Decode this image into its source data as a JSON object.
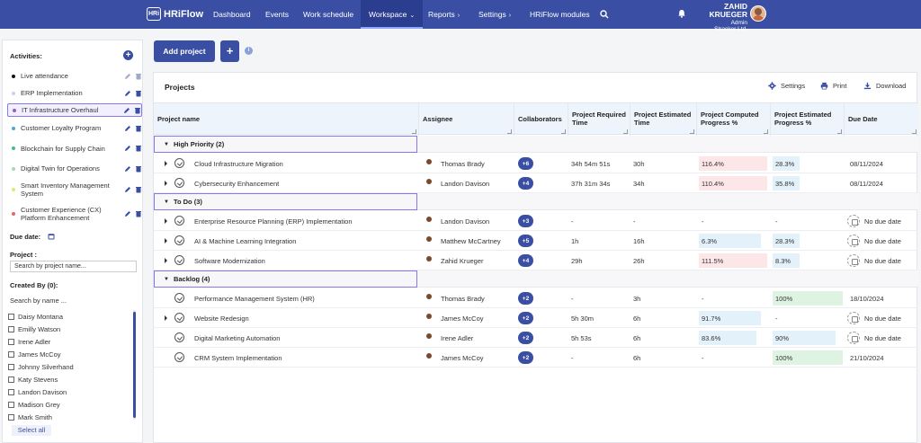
{
  "app": {
    "logo_mark": "HRi",
    "logo_text": "HRiFlow"
  },
  "nav": {
    "items": [
      {
        "label": "Dashboard"
      },
      {
        "label": "Events"
      },
      {
        "label": "Work schedule"
      },
      {
        "label": "Workspace",
        "chevron": "⌄"
      },
      {
        "label": "Reports",
        "chevron": "›"
      },
      {
        "label": "Settings",
        "chevron": "›"
      },
      {
        "label": "HRiFlow modules"
      }
    ],
    "user": {
      "name": "ZAHID KRUEGER",
      "role": "Admin",
      "company": "Stracker Ltd."
    }
  },
  "sidebar": {
    "activities_label": "Activities:",
    "activities": [
      {
        "label": "Live attendance",
        "color": "#111111"
      },
      {
        "label": "ERP Implementation",
        "color": "#c9d2f0"
      },
      {
        "label": "IT Infrastructure Overhaul",
        "color": "#9b59d0"
      },
      {
        "label": "Customer Loyalty Program",
        "color": "#4fa7d9"
      },
      {
        "label": "Blockchain for Supply Chain",
        "color": "#3cbf8a"
      },
      {
        "label": "Digital Twin for Operations",
        "color": "#9be0b0"
      },
      {
        "label": "Smart Inventory Management System",
        "color": "#d6ea72"
      },
      {
        "label": "Customer Experience (CX) Platform Enhancement",
        "color": "#e06b6b"
      }
    ],
    "due_date_label": "Due date:",
    "project_label": "Project :",
    "project_placeholder": "Search by project name...",
    "created_by_label": "Created By (0):",
    "search_name_label": "Search by name ...",
    "people": [
      "Daisy Montana",
      "Emilly Watson",
      "Irene Adler",
      "James McCoy",
      "Johnny Silverhand",
      "Katy Stevens",
      "Landon Davison",
      "Madison Grey",
      "Mark Smith"
    ],
    "select_all_label": "Select all"
  },
  "toolbar": {
    "add_project_label": "Add project",
    "plus_label": "+",
    "info_label": "i"
  },
  "panel": {
    "title": "Projects",
    "settings_label": "Settings",
    "print_label": "Print",
    "download_label": "Download",
    "columns": [
      "Project name",
      "Assignee",
      "Collaborators",
      "Project Required Time",
      "Project Estimated Time",
      "Project Computed Progress %",
      "Project Estimated Progress %",
      "Due Date"
    ]
  },
  "groups": [
    {
      "label": "High Priority (2)",
      "rows": [
        {
          "name": "Cloud Infrastructure Migration",
          "expandable": true,
          "assignee": "Thomas Brady",
          "avatar_color": "#9fb3cf",
          "collab": "+6",
          "required": "34h 54m 51s",
          "estimated": "30h",
          "computed": "116.4%",
          "computed_style": "red",
          "computed_fill": 0.98,
          "est_progress": "28.3%",
          "est_style": "blue",
          "est_fill": 0.28,
          "due": "08/11/2024"
        },
        {
          "name": "Cybersecurity Enhancement",
          "expandable": true,
          "assignee": "Landon Davison",
          "avatar_color": "#e4a07c",
          "collab": "+4",
          "required": "37h 31m 34s",
          "estimated": "34h",
          "computed": "110.4%",
          "computed_style": "red",
          "computed_fill": 0.98,
          "est_progress": "35.8%",
          "est_style": "blue",
          "est_fill": 0.36,
          "due": "08/11/2024"
        }
      ]
    },
    {
      "label": "To Do (3)",
      "rows": [
        {
          "name": "Enterprise Resource Planning (ERP) Implementation",
          "expandable": true,
          "assignee": "Landon Davison",
          "avatar_color": "#e4a07c",
          "collab": "+3",
          "required": "-",
          "estimated": "-",
          "computed": "-",
          "computed_style": "",
          "computed_fill": 0,
          "est_progress": "-",
          "est_style": "",
          "est_fill": 0,
          "due": "No due date"
        },
        {
          "name": "AI & Machine Learning Integration",
          "expandable": true,
          "assignee": "Matthew McCartney",
          "avatar_color": "#c9837a",
          "collab": "+5",
          "required": "1h",
          "estimated": "16h",
          "computed": "6.3%",
          "computed_style": "blue",
          "computed_fill": 0.06,
          "est_progress": "28.3%",
          "est_style": "blue",
          "est_fill": 0.28,
          "due": "No due date"
        },
        {
          "name": "Software Modernization",
          "expandable": true,
          "assignee": "Zahid Krueger",
          "avatar_color": "#e3b697",
          "collab": "+4",
          "required": "29h",
          "estimated": "26h",
          "computed": "111.5%",
          "computed_style": "red",
          "computed_fill": 0.98,
          "est_progress": "8.3%",
          "est_style": "blue",
          "est_fill": 0.08,
          "due": "No due date"
        }
      ]
    },
    {
      "label": "Backlog (4)",
      "rows": [
        {
          "name": "Performance Management System (HR)",
          "expandable": false,
          "assignee": "Thomas Brady",
          "avatar_color": "#9fb3cf",
          "collab": "+2",
          "required": "-",
          "estimated": "3h",
          "computed": "-",
          "computed_style": "",
          "computed_fill": 0,
          "est_progress": "100%",
          "est_style": "green",
          "est_fill": 1,
          "due": "18/10/2024"
        },
        {
          "name": "Website Redesign",
          "expandable": true,
          "assignee": "James McCoy",
          "avatar_color": "#e08a7a",
          "collab": "+2",
          "required": "5h 30m",
          "estimated": "6h",
          "computed": "91.7%",
          "computed_style": "blue",
          "computed_fill": 0.88,
          "est_progress": "-",
          "est_style": "",
          "est_fill": 0,
          "due": "No due date"
        },
        {
          "name": "Digital Marketing Automation",
          "expandable": false,
          "assignee": "Irene Adler",
          "avatar_color": "#d98a88",
          "collab": "+2",
          "required": "5h 53s",
          "estimated": "6h",
          "computed": "83.6%",
          "computed_style": "blue",
          "computed_fill": 0.82,
          "est_progress": "90%",
          "est_style": "blue",
          "est_fill": 0.9,
          "due": "No due date"
        },
        {
          "name": "CRM System Implementation",
          "expandable": false,
          "assignee": "James McCoy",
          "avatar_color": "#e08a7a",
          "collab": "+2",
          "required": "-",
          "estimated": "6h",
          "computed": "-",
          "computed_style": "",
          "computed_fill": 0,
          "est_progress": "100%",
          "est_style": "green",
          "est_fill": 1,
          "due": "21/10/2024"
        }
      ]
    }
  ]
}
